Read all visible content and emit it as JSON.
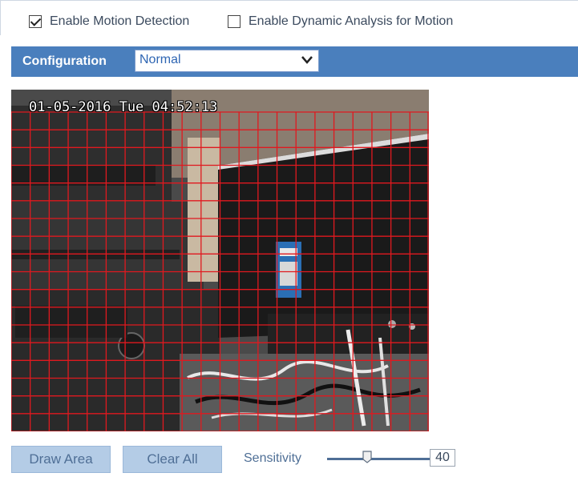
{
  "options": {
    "enable_motion_detection": {
      "label": "Enable Motion Detection",
      "checked": true
    },
    "enable_dynamic_analysis": {
      "label": "Enable Dynamic Analysis for Motion",
      "checked": false
    }
  },
  "configuration": {
    "label": "Configuration",
    "selected": "Normal"
  },
  "video": {
    "timestamp": "01-05-2016 Tue 04:52:13",
    "grid_color": "#e0191f"
  },
  "actions": {
    "draw_area_label": "Draw Area",
    "clear_all_label": "Clear All"
  },
  "sensitivity": {
    "label": "Sensitivity",
    "value": "40"
  },
  "colors": {
    "accent": "#4a7fbd",
    "button_bg": "#b4cce6"
  }
}
